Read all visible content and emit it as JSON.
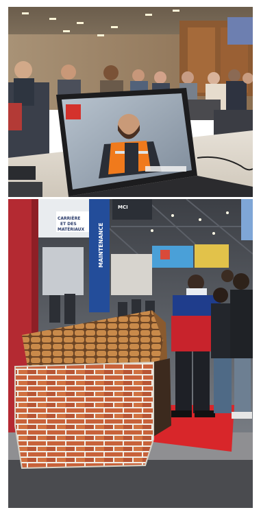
{
  "photos": [
    {
      "id": "conference",
      "content": "Audience watching a laptop video of a worker in a safety vest"
    },
    {
      "id": "trade-fair",
      "content": "Students standing next to a cardboard brick-house model at a trade fair"
    }
  ],
  "signs": {
    "left_banner_line1": "CARRIÈRE",
    "left_banner_line2": "ET DES",
    "left_banner_line3": "MATÉRIAUX",
    "vertical_banner": "MAINTENANCE",
    "top_sign": "MCI"
  },
  "colors": {
    "screen_red_logo": "#d4322c",
    "vest_orange": "#f07a1c",
    "brick": "#c8623a",
    "roof_tile": "#c98a4a",
    "floor_red": "#d8262a",
    "jacket_blue": "#1f3d8c",
    "jacket_red": "#c8232c"
  }
}
